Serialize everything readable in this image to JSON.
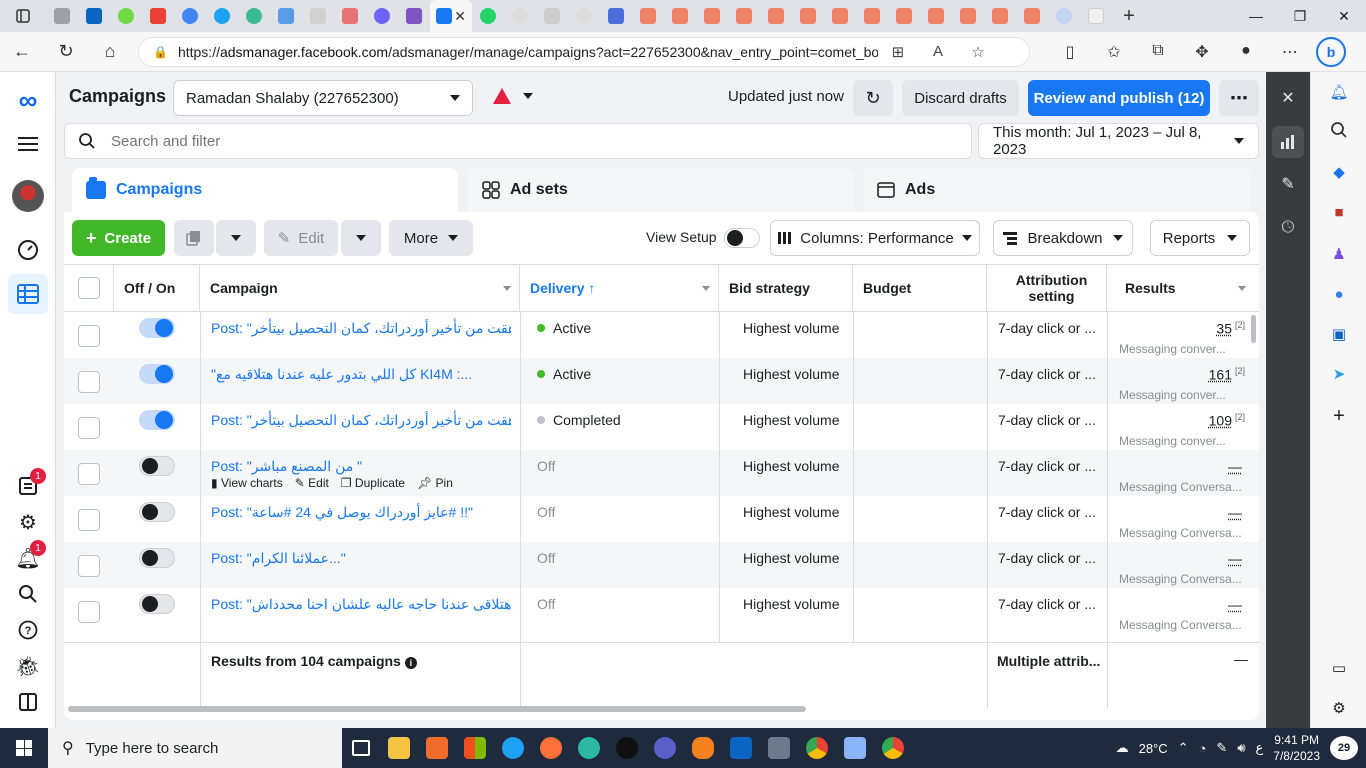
{
  "browser": {
    "url_prefix": "https://",
    "url_domain": "adsmanager.facebook.com",
    "url_rest": "/adsmanager/manage/campaigns?act=227652300&nav_entry_point=comet_boo..."
  },
  "header": {
    "title": "Campaigns",
    "account": "Ramadan Shalaby (227652300)",
    "updated": "Updated just now",
    "discard": "Discard drafts",
    "publish": "Review and publish (12)",
    "more": "⋯"
  },
  "search": {
    "placeholder": "Search and filter"
  },
  "date_range": "This month: Jul 1, 2023 – Jul 8, 2023",
  "tabs": {
    "campaigns": "Campaigns",
    "adsets": "Ad sets",
    "ads": "Ads"
  },
  "toolbar": {
    "create": "Create",
    "edit": "Edit",
    "more": "More",
    "view_setup": "View Setup",
    "columns": "Columns: Performance",
    "breakdown": "Breakdown",
    "reports": "Reports"
  },
  "columns": {
    "toggle": "Off / On",
    "campaign": "Campaign",
    "delivery": "Delivery ↑",
    "bid": "Bid strategy",
    "budget": "Budget",
    "attribution": "Attribution setting",
    "results": "Results"
  },
  "rows": [
    {
      "on": true,
      "prefix": "Post: ",
      "name": "\"زهقت من تأخير أوردراتك، كمان التحصيل بيتأخر#‎.\"",
      "delivery": "Active",
      "status": "active",
      "bid": "Highest volume",
      "attribution": "7-day click or ...",
      "result": "35",
      "note": "[2]",
      "result_sub": "Messaging conver..."
    },
    {
      "on": true,
      "prefix": "",
      "name": "\"كل اللي بتدور عليه عندنا هتلاقيه مع KI4M :...",
      "delivery": "Active",
      "status": "active",
      "bid": "Highest volume",
      "attribution": "7-day click or ...",
      "result": "161",
      "note": "[2]",
      "result_sub": "Messaging conver..."
    },
    {
      "on": true,
      "prefix": "Post: ",
      "name": "\"زهقت من تأخير أوردراتك، كمان التحصيل بيتأخر#‎.\"",
      "delivery": "Completed",
      "status": "completed",
      "bid": "Highest volume",
      "attribution": "7-day click or ...",
      "result": "109",
      "note": "[2]",
      "result_sub": "Messaging conver..."
    },
    {
      "on": false,
      "prefix": "Post: ",
      "name": "\"من المصنع مباشر \"",
      "delivery": "Off",
      "status": "off",
      "bid": "Highest volume",
      "attribution": "7-day click or ...",
      "result": "—",
      "note": "",
      "result_sub": "Messaging Conversa..."
    },
    {
      "on": false,
      "prefix": "Post: ",
      "name": "\"عايز أوردراك يوصل في 24 #ساعة# !!\"",
      "delivery": "Off",
      "status": "off",
      "bid": "Highest volume",
      "attribution": "7-day click or ...",
      "result": "—",
      "note": "",
      "result_sub": "Messaging Conversa..."
    },
    {
      "on": false,
      "prefix": "Post: ",
      "name": "\"عملائنا الكرام...\"",
      "delivery": "Off",
      "status": "off",
      "bid": "Highest volume",
      "attribution": "7-day click or ...",
      "result": "—",
      "note": "",
      "result_sub": "Messaging Conversa..."
    },
    {
      "on": false,
      "prefix": "Post: ",
      "name": "\"مش هتلاقى عندنا حاجه عاليه علشان احنا محدداش...\"",
      "delivery": "Off",
      "status": "off",
      "bid": "Highest volume",
      "attribution": "7-day click or ...",
      "result": "—",
      "note": "",
      "result_sub": "Messaging Conversa..."
    }
  ],
  "row_actions": {
    "charts": "View charts",
    "edit": "Edit",
    "duplicate": "Duplicate",
    "pin": "Pin"
  },
  "summary": {
    "label": "Results from 104 campaigns",
    "attribution": "Multiple attrib...",
    "results": "—"
  },
  "colors": {
    "active": "#42b72a",
    "completed": "#bec3c9",
    "accent": "#1877f2"
  },
  "taskbar": {
    "search": "Type here to search",
    "temp": "28°C",
    "lang": "ع",
    "time": "9:41 PM",
    "date": "7/8/2023",
    "notifications": "29"
  },
  "badges": {
    "campaigns_alert": "1",
    "notifications": "1"
  }
}
